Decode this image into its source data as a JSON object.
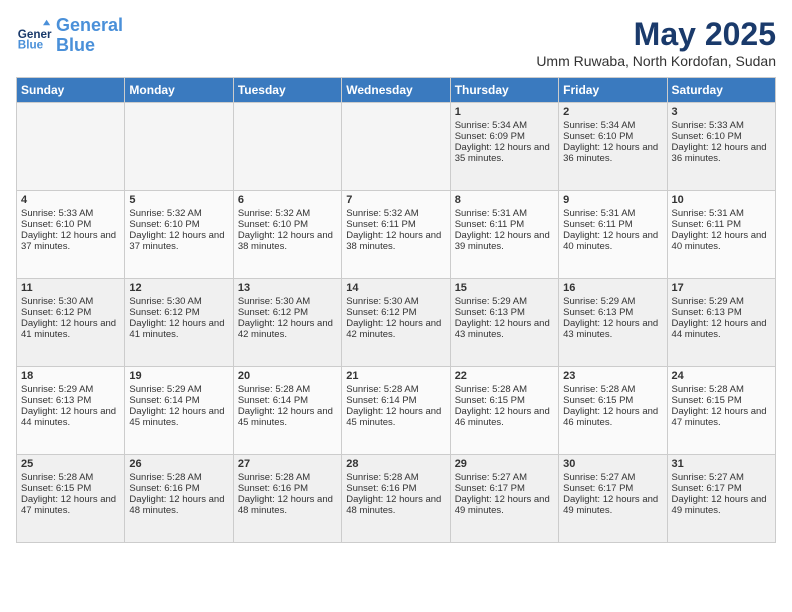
{
  "header": {
    "logo_line1": "General",
    "logo_line2": "Blue",
    "month": "May 2025",
    "location": "Umm Ruwaba, North Kordofan, Sudan"
  },
  "days_of_week": [
    "Sunday",
    "Monday",
    "Tuesday",
    "Wednesday",
    "Thursday",
    "Friday",
    "Saturday"
  ],
  "weeks": [
    [
      {
        "day": "",
        "empty": true
      },
      {
        "day": "",
        "empty": true
      },
      {
        "day": "",
        "empty": true
      },
      {
        "day": "",
        "empty": true
      },
      {
        "day": "1",
        "sunrise": "5:34 AM",
        "sunset": "6:09 PM",
        "daylight": "12 hours and 35 minutes."
      },
      {
        "day": "2",
        "sunrise": "5:34 AM",
        "sunset": "6:10 PM",
        "daylight": "12 hours and 36 minutes."
      },
      {
        "day": "3",
        "sunrise": "5:33 AM",
        "sunset": "6:10 PM",
        "daylight": "12 hours and 36 minutes."
      }
    ],
    [
      {
        "day": "4",
        "sunrise": "5:33 AM",
        "sunset": "6:10 PM",
        "daylight": "12 hours and 37 minutes."
      },
      {
        "day": "5",
        "sunrise": "5:32 AM",
        "sunset": "6:10 PM",
        "daylight": "12 hours and 37 minutes."
      },
      {
        "day": "6",
        "sunrise": "5:32 AM",
        "sunset": "6:10 PM",
        "daylight": "12 hours and 38 minutes."
      },
      {
        "day": "7",
        "sunrise": "5:32 AM",
        "sunset": "6:11 PM",
        "daylight": "12 hours and 38 minutes."
      },
      {
        "day": "8",
        "sunrise": "5:31 AM",
        "sunset": "6:11 PM",
        "daylight": "12 hours and 39 minutes."
      },
      {
        "day": "9",
        "sunrise": "5:31 AM",
        "sunset": "6:11 PM",
        "daylight": "12 hours and 40 minutes."
      },
      {
        "day": "10",
        "sunrise": "5:31 AM",
        "sunset": "6:11 PM",
        "daylight": "12 hours and 40 minutes."
      }
    ],
    [
      {
        "day": "11",
        "sunrise": "5:30 AM",
        "sunset": "6:12 PM",
        "daylight": "12 hours and 41 minutes."
      },
      {
        "day": "12",
        "sunrise": "5:30 AM",
        "sunset": "6:12 PM",
        "daylight": "12 hours and 41 minutes."
      },
      {
        "day": "13",
        "sunrise": "5:30 AM",
        "sunset": "6:12 PM",
        "daylight": "12 hours and 42 minutes."
      },
      {
        "day": "14",
        "sunrise": "5:30 AM",
        "sunset": "6:12 PM",
        "daylight": "12 hours and 42 minutes."
      },
      {
        "day": "15",
        "sunrise": "5:29 AM",
        "sunset": "6:13 PM",
        "daylight": "12 hours and 43 minutes."
      },
      {
        "day": "16",
        "sunrise": "5:29 AM",
        "sunset": "6:13 PM",
        "daylight": "12 hours and 43 minutes."
      },
      {
        "day": "17",
        "sunrise": "5:29 AM",
        "sunset": "6:13 PM",
        "daylight": "12 hours and 44 minutes."
      }
    ],
    [
      {
        "day": "18",
        "sunrise": "5:29 AM",
        "sunset": "6:13 PM",
        "daylight": "12 hours and 44 minutes."
      },
      {
        "day": "19",
        "sunrise": "5:29 AM",
        "sunset": "6:14 PM",
        "daylight": "12 hours and 45 minutes."
      },
      {
        "day": "20",
        "sunrise": "5:28 AM",
        "sunset": "6:14 PM",
        "daylight": "12 hours and 45 minutes."
      },
      {
        "day": "21",
        "sunrise": "5:28 AM",
        "sunset": "6:14 PM",
        "daylight": "12 hours and 45 minutes."
      },
      {
        "day": "22",
        "sunrise": "5:28 AM",
        "sunset": "6:15 PM",
        "daylight": "12 hours and 46 minutes."
      },
      {
        "day": "23",
        "sunrise": "5:28 AM",
        "sunset": "6:15 PM",
        "daylight": "12 hours and 46 minutes."
      },
      {
        "day": "24",
        "sunrise": "5:28 AM",
        "sunset": "6:15 PM",
        "daylight": "12 hours and 47 minutes."
      }
    ],
    [
      {
        "day": "25",
        "sunrise": "5:28 AM",
        "sunset": "6:15 PM",
        "daylight": "12 hours and 47 minutes."
      },
      {
        "day": "26",
        "sunrise": "5:28 AM",
        "sunset": "6:16 PM",
        "daylight": "12 hours and 48 minutes."
      },
      {
        "day": "27",
        "sunrise": "5:28 AM",
        "sunset": "6:16 PM",
        "daylight": "12 hours and 48 minutes."
      },
      {
        "day": "28",
        "sunrise": "5:28 AM",
        "sunset": "6:16 PM",
        "daylight": "12 hours and 48 minutes."
      },
      {
        "day": "29",
        "sunrise": "5:27 AM",
        "sunset": "6:17 PM",
        "daylight": "12 hours and 49 minutes."
      },
      {
        "day": "30",
        "sunrise": "5:27 AM",
        "sunset": "6:17 PM",
        "daylight": "12 hours and 49 minutes."
      },
      {
        "day": "31",
        "sunrise": "5:27 AM",
        "sunset": "6:17 PM",
        "daylight": "12 hours and 49 minutes."
      }
    ]
  ],
  "labels": {
    "sunrise_prefix": "Sunrise: ",
    "sunset_prefix": "Sunset: ",
    "daylight_prefix": "Daylight: "
  }
}
